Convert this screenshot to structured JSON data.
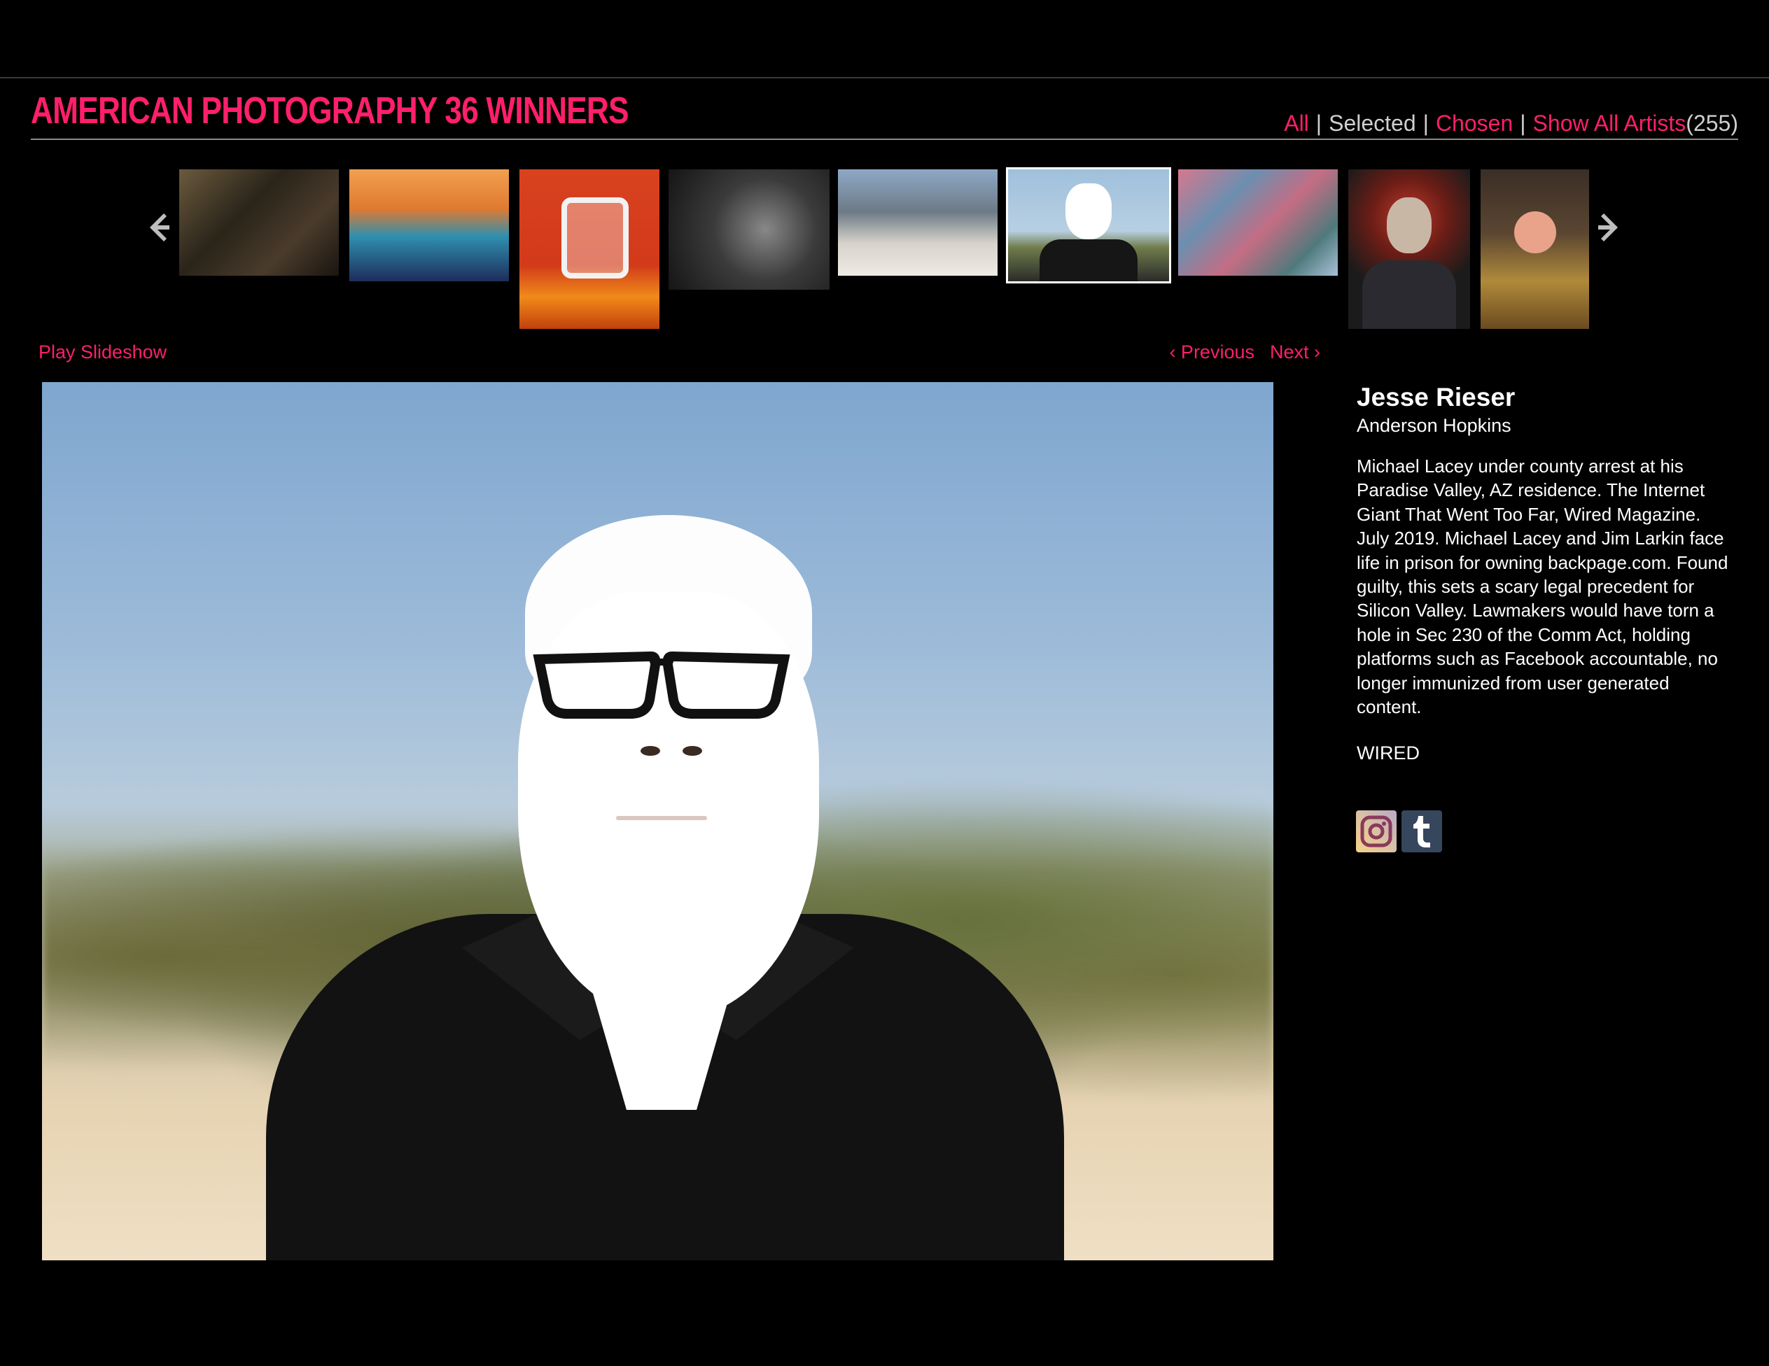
{
  "header": {
    "title": "AMERICAN PHOTOGRAPHY 36 WINNERS",
    "nav": {
      "all": "All",
      "selected": "Selected",
      "chosen": "Chosen",
      "show_all_artists": "Show All Artists",
      "count": "(255)",
      "separator": "|"
    }
  },
  "colors": {
    "accent": "#ff1f6b",
    "background": "#000000",
    "text": "#ffffff"
  },
  "controls": {
    "play_slideshow": "Play Slideshow",
    "previous": "‹ Previous",
    "next": "Next ›"
  },
  "caption": {
    "artist": "Jesse Rieser",
    "agency": "Anderson Hopkins",
    "description": "Michael Lacey under county arrest at his Paradise Valley, AZ residence. The Internet Giant That Went Too Far, Wired Magazine. July 2019. Michael Lacey and Jim Larkin face life in prison for owning backpage.com. Found guilty, this sets a scary legal precedent for Silicon Valley. Lawmakers would have torn a hole in Sec 230 of the Comm Act, holding platforms such as Facebook accountable, no longer immunized from user generated content.",
    "client": "WIRED"
  },
  "icons": {
    "prev_arrow": "arrow-left-icon",
    "next_arrow": "arrow-right-icon",
    "instagram": "instagram-icon",
    "tumblr": "tumblr-icon"
  }
}
